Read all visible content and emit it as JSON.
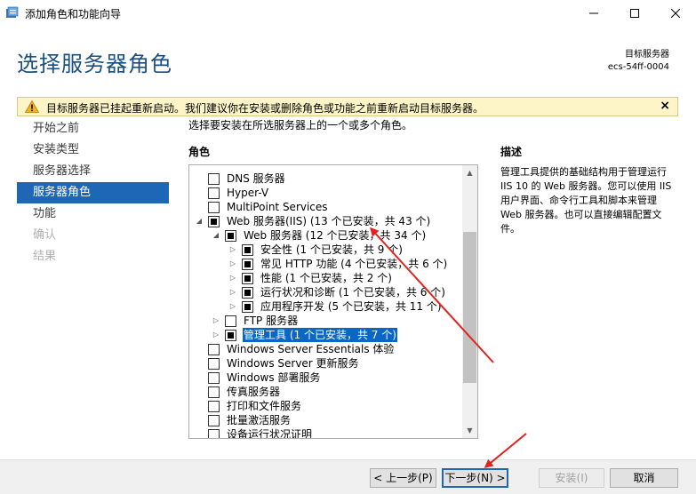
{
  "window": {
    "title": "添加角色和功能向导",
    "minimize_icon": "minimize-icon",
    "maximize_icon": "maximize-icon",
    "close_icon": "close-icon"
  },
  "header": {
    "page_title": "选择服务器角色",
    "target_label": "目标服务器",
    "target_name": "ecs-54ff-0004"
  },
  "warning": {
    "text": "目标服务器已挂起重新启动。我们建议你在安装或删除角色或功能之前重新启动目标服务器。",
    "close_label": "×"
  },
  "nav": {
    "items": [
      {
        "label": "开始之前",
        "state": "normal"
      },
      {
        "label": "安装类型",
        "state": "normal"
      },
      {
        "label": "服务器选择",
        "state": "normal"
      },
      {
        "label": "服务器角色",
        "state": "active"
      },
      {
        "label": "功能",
        "state": "normal"
      },
      {
        "label": "确认",
        "state": "disabled"
      },
      {
        "label": "结果",
        "state": "disabled"
      }
    ]
  },
  "main": {
    "instruction": "选择要安装在所选服务器上的一个或多个角色。",
    "roles_heading": "角色",
    "roles": [
      {
        "label": "DNS 服务器"
      },
      {
        "label": "Hyper-V"
      },
      {
        "label": "MultiPoint Services"
      },
      {
        "label": "Web 服务器(IIS) (13 个已安装，共 43 个)"
      },
      {
        "label": "Web 服务器 (12 个已安装，共 34 个)"
      },
      {
        "label": "安全性 (1 个已安装，共 9 个)"
      },
      {
        "label": "常见 HTTP 功能 (4 个已安装，共 6 个)"
      },
      {
        "label": "性能 (1 个已安装，共 2 个)"
      },
      {
        "label": "运行状况和诊断 (1 个已安装，共 6 个)"
      },
      {
        "label": "应用程序开发 (5 个已安装，共 11 个)"
      },
      {
        "label": "FTP 服务器"
      },
      {
        "label": "管理工具 (1 个已安装，共 7 个)"
      },
      {
        "label": "Windows Server Essentials 体验"
      },
      {
        "label": "Windows Server 更新服务"
      },
      {
        "label": "Windows 部署服务"
      },
      {
        "label": "传真服务器"
      },
      {
        "label": "打印和文件服务"
      },
      {
        "label": "批量激活服务"
      },
      {
        "label": "设备运行状况证明"
      }
    ]
  },
  "description": {
    "heading": "描述",
    "text": "管理工具提供的基础结构用于管理运行 IIS 10 的 Web 服务器。您可以使用 IIS 用户界面、命令行工具和脚本来管理 Web 服务器。也可以直接编辑配置文件。"
  },
  "buttons": {
    "prev": "< 上一步(P)",
    "next": "下一步(N) >",
    "install": "安装(I)",
    "cancel": "取消"
  },
  "colors": {
    "accent": "#1e67b6",
    "title": "#1a4f7f",
    "warning_bg": "#fdf5c8",
    "annotation_arrow": "#e0231c"
  }
}
